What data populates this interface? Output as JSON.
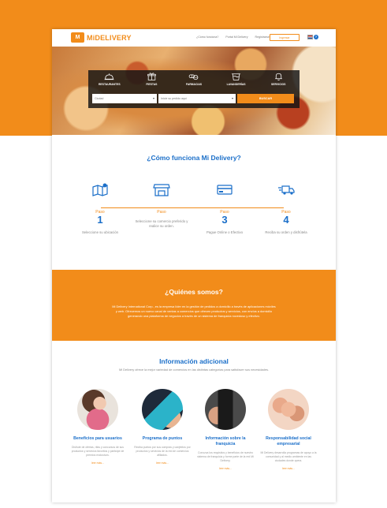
{
  "header": {
    "logo_mark": "M",
    "logo_text": "MiDELIVERY",
    "nav": [
      "¿Cómo funciona?",
      "Portal Mi Delivery",
      "Registrarse"
    ],
    "login_label": "Ingresar",
    "help_label": "?"
  },
  "hero": {
    "categories": [
      {
        "label": "RESTAURANTES",
        "icon": "cloche-icon"
      },
      {
        "label": "FIESTAS",
        "icon": "gift-icon"
      },
      {
        "label": "FARMACIAS",
        "icon": "pills-icon"
      },
      {
        "label": "LAVANDERÍAS",
        "icon": "laundry-icon"
      },
      {
        "label": "SERVICIOS",
        "icon": "bell-icon"
      }
    ],
    "city_select": "Ciudad",
    "search_placeholder": "Inicie su pedido aquí",
    "search_button": "BUSCAR"
  },
  "como_funciona": {
    "title": "¿Cómo funciona Mi Delivery?",
    "steps": [
      {
        "word": "Paso",
        "number": "1",
        "desc": "Seleccione su ubicación",
        "icon": "map-pin-icon"
      },
      {
        "word": "Paso",
        "number": "",
        "desc": "Seleccione su comercio preferido y realice su orden.",
        "icon": "storefront-icon"
      },
      {
        "word": "Paso",
        "number": "3",
        "desc": "Pague Online o Efectivo",
        "icon": "credit-card-icon"
      },
      {
        "word": "Paso",
        "number": "4",
        "desc": "Reciba su orden y disfrútela",
        "icon": "delivery-truck-icon"
      }
    ]
  },
  "quienes": {
    "title": "¿Quiénes somos?",
    "text": "Mi Delivery International Corp., es la empresa líder en la gestión de pedidos a domicilio a través de aplicaciones móviles y web. Ofrecemos un nuevo canal de ventas a comercios que ofrecen productos y servicios, con envíos a domicilio generando una plataforma de negocios a través de un sistema de franquicia novedoso y efectivo."
  },
  "info": {
    "title": "Información adicional",
    "subtitle": "Mi Delivery ofrece la mejor variedad de comercios en las distintas categorías para satisfacer sus necesidades.",
    "cards": [
      {
        "title": "Beneficios para usuarios",
        "desc": "Disfrute de ofertas, rifas y concursos de sus productos y servicios favoritos y participe de premios exclusivos.",
        "link": "leer más..."
      },
      {
        "title": "Programa de puntos",
        "desc": "Reciba puntos por sus compras y canjéelos por productos y servicios de la red de comercios afiliados.",
        "link": "leer más..."
      },
      {
        "title": "Información sobre la franquicia",
        "desc": "Conozca los requisitos y beneficios de nuestro sistema de franquicia y forme parte de la red Mi Delivery.",
        "link": "leer más..."
      },
      {
        "title": "Responsabilidad social empresarial",
        "desc": "Mi Delivery desarrolla programas de apoyo a la comunidad y al medio ambiente en las ciudades donde opera.",
        "link": "leer más..."
      }
    ]
  },
  "colors": {
    "accent": "#f28c1a",
    "brand_blue": "#1b6fc9"
  }
}
